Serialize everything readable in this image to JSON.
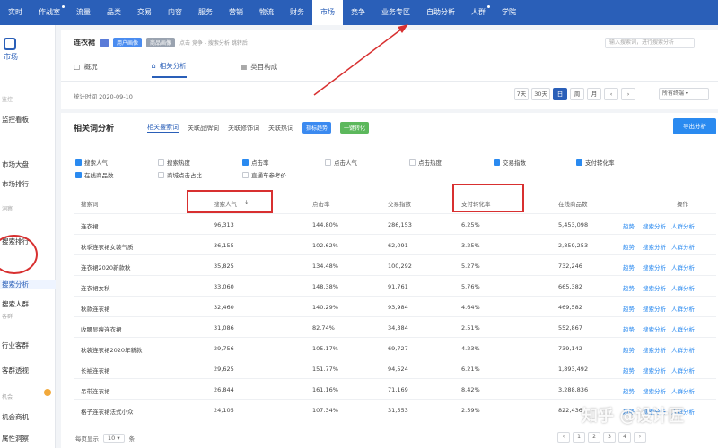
{
  "topnav": {
    "items": [
      "实时",
      "作战室",
      "流量",
      "品类",
      "交易",
      "内容",
      "服务",
      "营销",
      "物流",
      "财务",
      "市场",
      "竞争",
      "业务专区",
      "自助分析",
      "人群",
      "学院"
    ],
    "active": "市场"
  },
  "sidebar": {
    "brand": "市场",
    "items": [
      {
        "label": "监控看板",
        "group": false
      },
      {
        "label": "市场大盘",
        "group": false
      },
      {
        "label": "市场排行",
        "group": false
      },
      {
        "label": "搜索排行",
        "group": false
      },
      {
        "label": "搜索分析",
        "group": false,
        "active": true
      },
      {
        "label": "搜索人群",
        "group": false
      },
      {
        "label": "行业客群",
        "group": false
      },
      {
        "label": "客群透视",
        "group": false
      },
      {
        "label": "机会商机",
        "group": false
      },
      {
        "label": "属性洞察",
        "group": false
      }
    ]
  },
  "header": {
    "store_name": "连衣裙",
    "tag_user": "用户画像",
    "tag_item": "商品画像",
    "crumb": "点击 竞争 - 搜索分析 跳转后",
    "search_placeholder": "输入搜索词，进行搜索分析",
    "tabs": [
      {
        "label": "概况",
        "icon": "▢"
      },
      {
        "label": "相关分析",
        "icon": "⌂"
      },
      {
        "label": "类目构成",
        "icon": "▤"
      }
    ],
    "stat_time": "统计时间 2020-09-10",
    "periods": [
      "7天",
      "30天",
      "日",
      "周",
      "月"
    ],
    "active_period": "日",
    "channel": "所有终端"
  },
  "main": {
    "title": "相关词分析",
    "subtabs": [
      "相关搜索词",
      "关联品牌词",
      "关联修饰词",
      "关联热词"
    ],
    "active_subtab": "相关搜索词",
    "btn_blue": "指标趋势",
    "btn_green": "一键转化",
    "export": "导出分析",
    "metrics": [
      {
        "label": "搜索人气",
        "on": true
      },
      {
        "label": "搜索热度",
        "on": false
      },
      {
        "label": "点击率",
        "on": true
      },
      {
        "label": "点击人气",
        "on": false
      },
      {
        "label": "点击热度",
        "on": false
      },
      {
        "label": "交易指数",
        "on": true
      },
      {
        "label": "支付转化率",
        "on": true
      },
      {
        "label": "在线商品数",
        "on": true
      },
      {
        "label": "商城点击占比",
        "on": false
      },
      {
        "label": "直通车参考价",
        "on": false
      }
    ],
    "columns": [
      "搜索词",
      "搜索人气",
      "点击率",
      "交易指数",
      "支付转化率",
      "在线商品数",
      "操作"
    ],
    "rows": [
      [
        "连衣裙",
        "96,313",
        "144.80%",
        "286,153",
        "6.25%",
        "5,453,098"
      ],
      [
        "秋季连衣裙女装气质",
        "36,155",
        "102.62%",
        "62,091",
        "3.25%",
        "2,859,253"
      ],
      [
        "连衣裙2020新款秋",
        "35,825",
        "134.48%",
        "100,292",
        "5.27%",
        "732,246"
      ],
      [
        "连衣裙女秋",
        "33,060",
        "148.38%",
        "91,761",
        "5.76%",
        "665,382"
      ],
      [
        "秋款连衣裙",
        "32,460",
        "140.29%",
        "93,984",
        "4.64%",
        "469,582"
      ],
      [
        "收腰显瘦连衣裙",
        "31,086",
        "82.74%",
        "34,384",
        "2.51%",
        "552,867"
      ],
      [
        "秋装连衣裙2020年新款",
        "29,756",
        "105.17%",
        "69,727",
        "4.23%",
        "739,142"
      ],
      [
        "长袖连衣裙",
        "29,625",
        "151.77%",
        "94,524",
        "6.21%",
        "1,893,492"
      ],
      [
        "吊带连衣裙",
        "26,844",
        "161.16%",
        "71,169",
        "8.42%",
        "3,288,836"
      ],
      [
        "格子连衣裙法式小众",
        "24,105",
        "107.34%",
        "31,553",
        "2.59%",
        "822,436"
      ]
    ],
    "ops": [
      "趋势",
      "搜索分析",
      "人群分析"
    ],
    "footer": {
      "label": "每页显示",
      "size": "10",
      "unit": "条"
    },
    "pager": [
      "‹",
      "1",
      "2",
      "3",
      "4",
      "›"
    ]
  },
  "watermark": "知乎 @设计匠"
}
